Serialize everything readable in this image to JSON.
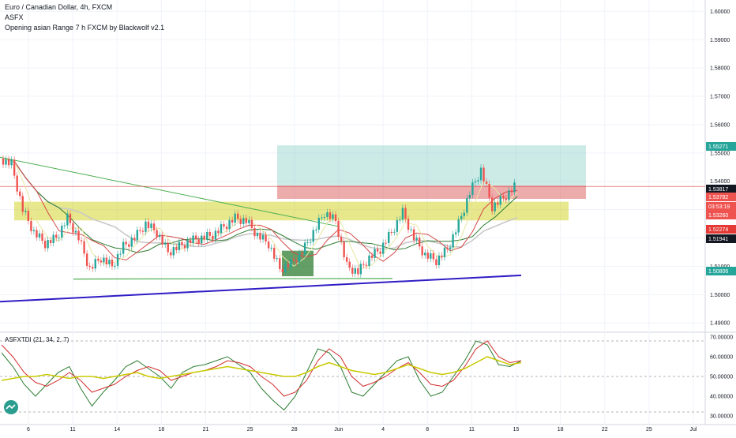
{
  "header": {
    "title": "Euro / Canadian Dollar, 4h, FXCM",
    "indicator1": "ASFX",
    "indicator2": "Opening asian Range 7 h FXCM by Blackwolf v2.1"
  },
  "oscillator": {
    "title": "ASFXTDI (21, 34, 2, 7)",
    "ticks": [
      "70.00000",
      "60.00000",
      "50.00000",
      "40.00000",
      "30.00000"
    ]
  },
  "price_axis_ticks": [
    "1.60000",
    "1.59000",
    "1.58000",
    "1.57000",
    "1.56000",
    "1.55000",
    "1.54000",
    "1.53000",
    "1.52000",
    "1.51000",
    "1.50000",
    "1.49000"
  ],
  "price_labels": [
    {
      "text": "1.55271",
      "color": "#26a69a"
    },
    {
      "text": "1.53817",
      "color": "#131722"
    },
    {
      "text": "1.53782",
      "color": "#ef5350"
    },
    {
      "text": "03:53:19",
      "color": "#ef5350"
    },
    {
      "text": "1.53260",
      "color": "#ef5350"
    },
    {
      "text": "1.52274",
      "color": "#e53935"
    },
    {
      "text": "1.51941",
      "color": "#131722"
    },
    {
      "text": "1.50806",
      "color": "#26a69a"
    }
  ],
  "time_axis": [
    "6",
    "11",
    "14",
    "18",
    "21",
    "25",
    "28",
    "Jun",
    "4",
    "8",
    "11",
    "15",
    "18",
    "22",
    "25",
    "Jul"
  ],
  "colors": {
    "up": "#26a69a",
    "down": "#ef5350",
    "trend": "#4caf50",
    "channel": "#2f1dc4",
    "zone": "#c9c900",
    "box_green": "#6ec6bb",
    "box_red": "#d64848",
    "ma_green": "#2e7d32"
  },
  "chart_data": {
    "type": "candlestick",
    "title": "Euro / Canadian Dollar, 4h, FXCM",
    "x_ticks": [
      "6",
      "11",
      "14",
      "18",
      "21",
      "25",
      "28",
      "Jun",
      "4",
      "8",
      "11",
      "15",
      "18",
      "22",
      "25",
      "Jul"
    ],
    "y_ticks": [
      1.6,
      1.59,
      1.58,
      1.57,
      1.56,
      1.55,
      1.54,
      1.53,
      1.52,
      1.51,
      1.5,
      1.49
    ],
    "ylim": [
      1.487,
      1.604
    ],
    "close_path": [
      1.548,
      1.546,
      1.53,
      1.522,
      1.518,
      1.52,
      1.527,
      1.52,
      1.509,
      1.513,
      1.51,
      1.517,
      1.52,
      1.525,
      1.522,
      1.515,
      1.517,
      1.519,
      1.52,
      1.521,
      1.524,
      1.527,
      1.526,
      1.521,
      1.518,
      1.509,
      1.511,
      1.515,
      1.522,
      1.529,
      1.526,
      1.51,
      1.508,
      1.513,
      1.516,
      1.522,
      1.529,
      1.52,
      1.514,
      1.512,
      1.516,
      1.525,
      1.536,
      1.544,
      1.531,
      1.534,
      1.538
    ],
    "zones": [
      {
        "name": "box-upper",
        "from": 1.5385,
        "to": 1.5527
      },
      {
        "name": "box-lower",
        "from": 1.5338,
        "to": 1.5385
      },
      {
        "name": "range-band",
        "from": 1.5262,
        "to": 1.5328
      }
    ],
    "oscillator": {
      "title": "ASFXTDI (21, 34, 2, 7)",
      "ylim": [
        28,
        72
      ],
      "levels": [
        68,
        50,
        32
      ],
      "yellow": [
        48,
        49,
        50,
        50,
        51,
        50,
        49,
        50,
        50,
        49,
        50,
        51,
        52,
        50,
        49,
        50,
        51,
        52,
        53,
        54,
        55,
        54,
        53,
        52,
        51,
        50,
        50,
        52,
        55,
        57,
        55,
        53,
        52,
        51,
        52,
        54,
        56,
        54,
        52,
        51,
        52,
        54,
        57,
        60,
        58,
        56,
        57
      ],
      "red": [
        66,
        60,
        52,
        47,
        45,
        48,
        52,
        48,
        42,
        44,
        46,
        50,
        53,
        55,
        53,
        48,
        50,
        52,
        53,
        55,
        58,
        57,
        55,
        50,
        46,
        40,
        42,
        48,
        58,
        64,
        60,
        50,
        45,
        47,
        50,
        54,
        57,
        52,
        46,
        45,
        48,
        55,
        64,
        68,
        60,
        57,
        58
      ],
      "green": [
        62,
        55,
        46,
        40,
        46,
        52,
        55,
        44,
        35,
        42,
        48,
        55,
        58,
        54,
        50,
        44,
        52,
        55,
        56,
        58,
        60,
        56,
        52,
        44,
        38,
        33,
        40,
        52,
        64,
        62,
        55,
        42,
        40,
        46,
        52,
        58,
        60,
        48,
        40,
        42,
        50,
        58,
        68,
        66,
        56,
        55,
        58
      ]
    }
  }
}
